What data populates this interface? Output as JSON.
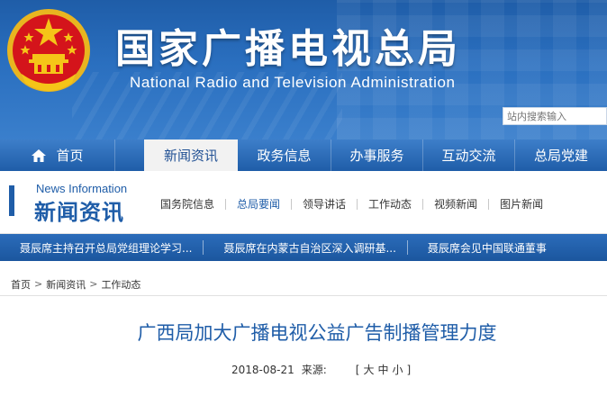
{
  "header": {
    "title_cn": "国家广播电视总局",
    "title_en": "National Radio and Television Administration",
    "search_placeholder": "站内搜索输入"
  },
  "main_nav": {
    "items": [
      {
        "label": "首页",
        "icon": "home-icon"
      },
      {
        "label": "新闻资讯",
        "active": true
      },
      {
        "label": "政务信息"
      },
      {
        "label": "办事服务"
      },
      {
        "label": "互动交流"
      },
      {
        "label": "总局党建"
      }
    ]
  },
  "section": {
    "label_en": "News Information",
    "label_cn": "新闻资讯",
    "subnav": [
      {
        "label": "国务院信息"
      },
      {
        "label": "总局要闻",
        "active": true
      },
      {
        "label": "领导讲话"
      },
      {
        "label": "工作动态"
      },
      {
        "label": "视频新闻"
      },
      {
        "label": "图片新闻"
      }
    ]
  },
  "ticker": {
    "items": [
      "聂辰席主持召开总局党组理论学习...",
      "聂辰席在内蒙古自治区深入调研基...",
      "聂辰席会见中国联通董事"
    ]
  },
  "breadcrumb": {
    "items": [
      "首页",
      "新闻资讯",
      "工作动态"
    ],
    "separator": ">"
  },
  "article": {
    "title": "广西局加大广播电视公益广告制播管理力度",
    "date": "2018-08-21",
    "source_label": "来源:",
    "font_size": {
      "open": "[",
      "large": "大",
      "medium": "中",
      "small": "小",
      "close": "]"
    }
  },
  "colors": {
    "brand_blue": "#1f5da8",
    "nav_active_bg": "#f2f2f2",
    "emblem_red": "#d4141b",
    "emblem_gold": "#f5c518"
  }
}
